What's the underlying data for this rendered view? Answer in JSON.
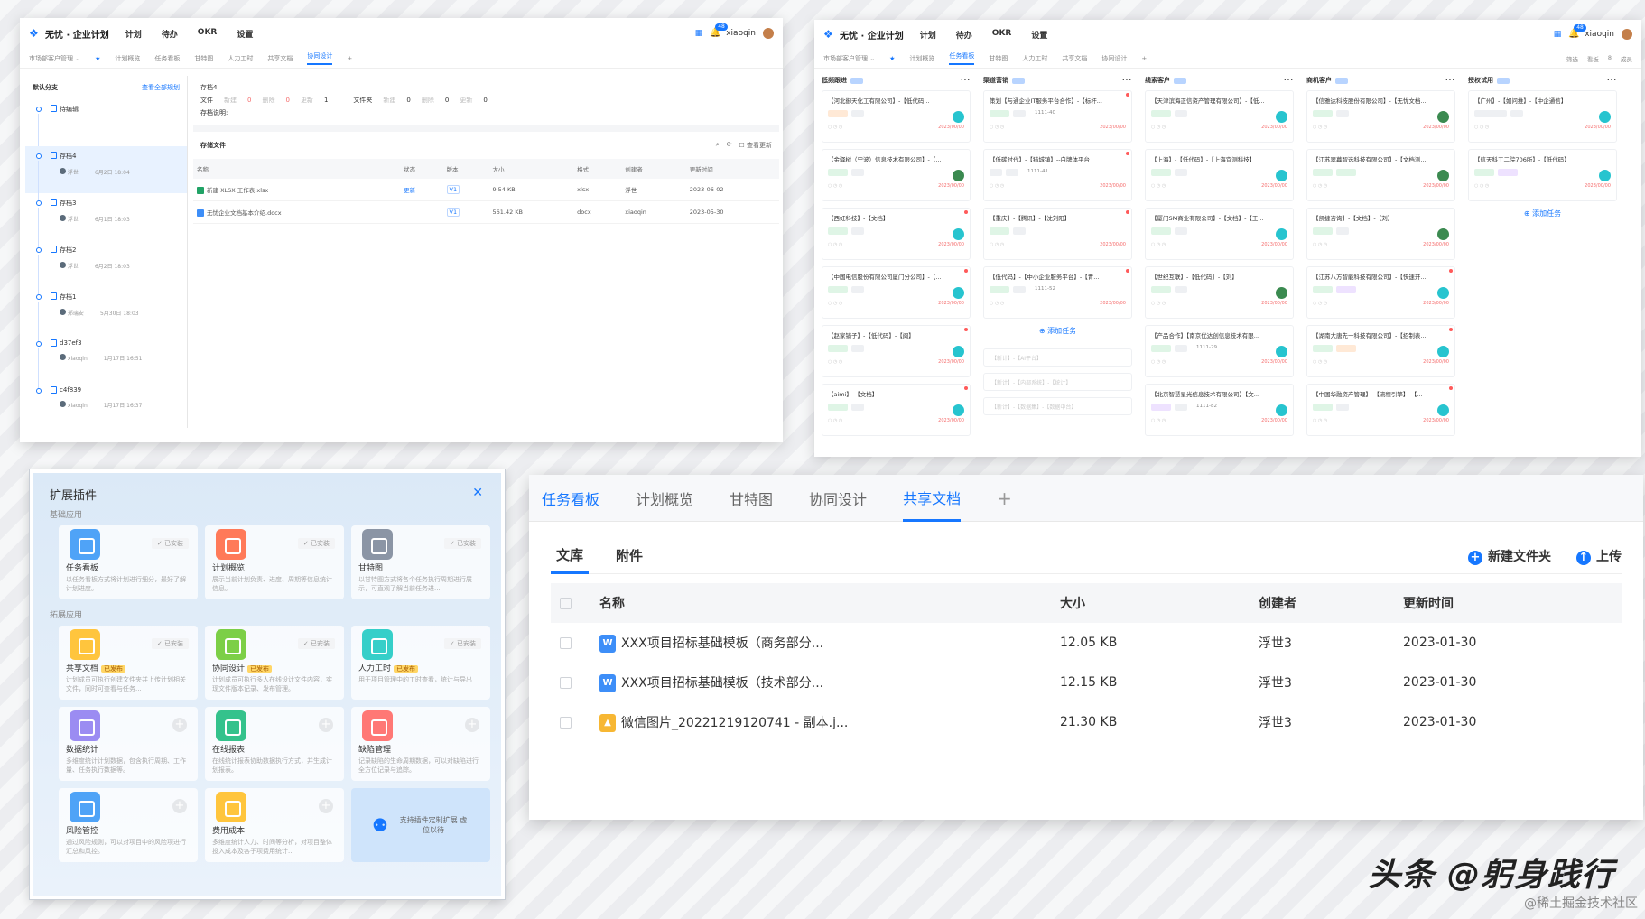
{
  "brand": {
    "name": "无忧 · 企业计划",
    "user": "xiaoqin",
    "badge": "48"
  },
  "menu": [
    "计划",
    "待办",
    "OKR",
    "设置"
  ],
  "panelA": {
    "project": "市场部客户管理",
    "tabs": [
      "计划概览",
      "任务看板",
      "甘特图",
      "人力工时",
      "共享文档",
      "协同设计"
    ],
    "sidebar": {
      "title": "默认分支",
      "link": "查看全部规划"
    },
    "versions": [
      {
        "name": "待编辑",
        "user": "",
        "time": ""
      },
      {
        "name": "存档4",
        "user": "浮世",
        "time": "6月2日 18:04"
      },
      {
        "name": "存档3",
        "user": "浮世",
        "time": "6月1日 18:03"
      },
      {
        "name": "存档2",
        "user": "浮世",
        "time": "6月2日 18:03"
      },
      {
        "name": "存档1",
        "user": "郑瑞安",
        "time": "5月30日 18:03"
      },
      {
        "name": "d37ef3",
        "user": "xiaoqin",
        "time": "1月17日 16:51"
      },
      {
        "name": "c4f839",
        "user": "xiaoqin",
        "time": "1月17日 16:37"
      }
    ],
    "info": {
      "title": "存档4",
      "file": "文件",
      "folder": "文件夹",
      "a": "新建",
      "b": "删除",
      "c": "更新",
      "desc": "存档说明:",
      "n0": "0",
      "n1": "1"
    },
    "section": "存储文件",
    "viewUpdates": "查看更新",
    "headers": [
      "名称",
      "状态",
      "版本",
      "大小",
      "格式",
      "创建者",
      "更新时间"
    ],
    "rows": [
      {
        "name": "新建 XLSX 工作表.xlsx",
        "status": "",
        "ver": "V1",
        "size": "9.54 KB",
        "fmt": "xlsx",
        "by": "浮世",
        "time": "2023-06-02"
      },
      {
        "name": "无忧企业文档基本介绍.docx",
        "status": "",
        "ver": "V1",
        "size": "561.42 KB",
        "fmt": "docx",
        "by": "xiaoqin",
        "time": "2023-05-30"
      }
    ],
    "rowStatus": "更新"
  },
  "panelB": {
    "tools": [
      "筛选",
      "看板",
      "8",
      "成员"
    ],
    "columns": [
      {
        "title": "低频跟进",
        "cards": [
          "【河北御天化工有限公司】-【低代码...",
          "【金驿树（宁波）信息技术有限公司】-【...",
          "【西虹科技】-【文档】",
          "【中国电信股份有限公司厦门分公司】-【...",
          "【赵家铺子】-【低代码】-【闽】",
          "【aimi】-【文档】"
        ],
        "add": ""
      },
      {
        "title": "渠道营销",
        "cards": [
          "策划【与通企业IT服务平台合作】-【标杆...",
          "【低碳时代】-【猎城镇】--白牌体平台",
          "【重庆】-【腾讯】-【沈刘阳】",
          "【低代码】-【中小企业服务平台】-【青..."
        ],
        "extra": [
          "1111-40",
          "1111-41",
          "",
          "1111-52"
        ],
        "add": "添加任务",
        "ghosts": [
          "【新计】-【AI平台】",
          "【新计】-【内部系统】-【统计】",
          "【新计】-【数据集】-【数据中台】"
        ]
      },
      {
        "title": "线索客户",
        "cards": [
          "【天津滨海正信资产管理有限公司】-【低...",
          "【上海】-【低代码】-【上海宜测科技】",
          "【厦门SM商业有限公司】-【文档】-【王...",
          "【世纪互联】-【低代码】-【刘】",
          "【产品合作】【南京优达创信息技术有限...",
          "【北京智慧星光信息技术有限公司】【文..."
        ],
        "extra": [
          "",
          "",
          "",
          "",
          "1111-29",
          "1111-82"
        ]
      },
      {
        "title": "商机客户",
        "cards": [
          "【信雅达科技股份有限公司】-【无忧文档...",
          "【江苏翠暮智选科技有限公司】-【文档测...",
          "【凯捷咨询】-【文档】-【刘】",
          "【江苏八方智能科技有限公司】-【快速开...",
          "【湖南大唐先一科技有限公司】-【招制表...",
          "【中国华融资产管理】-【流程引擎】-【..."
        ]
      },
      {
        "title": "授权试用",
        "cards": [
          "【广州】-【如问推】-【中企通信】",
          "【航天科工二院706所】-【低代码】"
        ],
        "add": "添加任务"
      }
    ]
  },
  "plugins": {
    "title": "扩展插件",
    "basic": "基础应用",
    "ext": "拓展应用",
    "installed": "已安装",
    "published": "已发布",
    "items": [
      {
        "name": "任务看板",
        "desc": "以任务看板方式将计划进行细分，最好了解计划进度。",
        "state": "installed",
        "color": "#4fa3f7"
      },
      {
        "name": "计划概览",
        "desc": "展示当前计划负责、进度、周期等信息统计信息。",
        "state": "installed",
        "color": "#ff7a59"
      },
      {
        "name": "甘特图",
        "desc": "以甘特图方式将各个任务执行周期进行展示，可直观了解当前任务进...",
        "state": "installed",
        "color": "#8b95a5"
      },
      {
        "name": "共享文档",
        "desc": "计划成员可执行创建文件夹并上传计划相关文件，同时可查看与任务...",
        "state": "installed",
        "pub": true,
        "color": "#ffc53d"
      },
      {
        "name": "协同设计",
        "desc": "计划成员可执行多人在线设计文件内容，实现文件版本记录、发布管理。",
        "state": "installed",
        "pub": true,
        "color": "#7ccf47"
      },
      {
        "name": "人力工时",
        "desc": "用于项目管理中的工时查看，统计与导出",
        "state": "installed",
        "pub": true,
        "color": "#36cfc9"
      },
      {
        "name": "数据统计",
        "desc": "多维度统计计划数据，包含执行周期、工作量、任务执行数据等。",
        "state": "add",
        "color": "#9b8cf2"
      },
      {
        "name": "在线报表",
        "desc": "在线统计报表协助数据执行方式，并生成计划报表。",
        "state": "add",
        "color": "#34c28c"
      },
      {
        "name": "缺陷管理",
        "desc": "记录缺陷的生命周期数据，可以对缺陷进行全方位记录与追踪。",
        "state": "add",
        "color": "#ff7875"
      },
      {
        "name": "风险管控",
        "desc": "通过风险规则，可以对项目中的风险项进行汇总和风控。",
        "state": "add",
        "color": "#4fa3f7"
      },
      {
        "name": "费用成本",
        "desc": "多维度统计人力、时间等分析，对项目整体投入成本及各子项费用统计...",
        "state": "add",
        "color": "#ffc53d"
      }
    ],
    "cta": "支持插件定制扩展 虚位以待"
  },
  "docs": {
    "tabs": [
      "任务看板",
      "计划概览",
      "甘特图",
      "协同设计",
      "共享文档"
    ],
    "active": 4,
    "sub": [
      "文库",
      "附件"
    ],
    "newFolder": "新建文件夹",
    "upload": "上传",
    "headers": [
      "名称",
      "大小",
      "创建者",
      "更新时间"
    ],
    "rows": [
      {
        "name": "XXX项目招标基础模板（商务部分...",
        "size": "12.05 KB",
        "by": "浮世3",
        "time": "2023-01-30",
        "type": "word"
      },
      {
        "name": "XXX项目招标基础模板（技术部分...",
        "size": "12.15 KB",
        "by": "浮世3",
        "time": "2023-01-30",
        "type": "word"
      },
      {
        "name": "微信图片_20221219120741 - 副本.j...",
        "size": "21.30 KB",
        "by": "浮世3",
        "time": "2023-01-30",
        "type": "image"
      }
    ]
  },
  "watermark": {
    "main": "头条 @躬身践行",
    "sub": "@稀土掘金技术社区"
  }
}
